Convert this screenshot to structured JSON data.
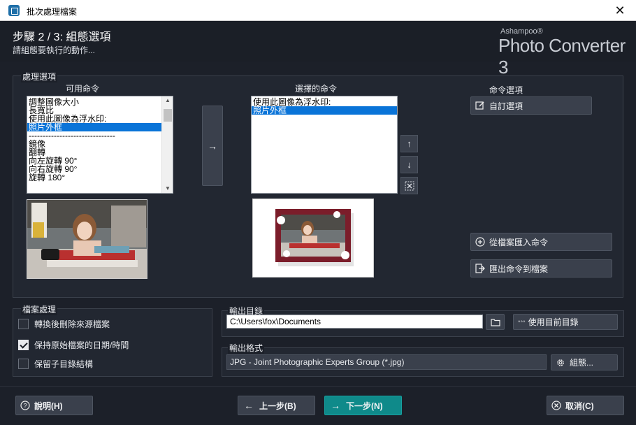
{
  "window": {
    "title": "批次處理檔案",
    "close": "✕"
  },
  "header": {
    "step_title": "步驟 2 / 3: 組態選項",
    "step_subtitle": "請組態要執行的動作...",
    "brand_small": "Ashampoo®",
    "brand_large": "Photo Converter 3"
  },
  "processing": {
    "label": "處理選項",
    "available_label": "可用命令",
    "selected_label": "選擇的命令",
    "options_label": "命令選項",
    "available_items": [
      "調整圖像大小",
      "長寬比",
      "使用此圖像為浮水印:",
      "照片外框",
      "-------------------------------",
      "鏡像",
      "翻轉",
      "向左旋轉 90°",
      "向右旋轉 90°",
      "旋轉 180°"
    ],
    "available_selected_index": 3,
    "selected_items": [
      "使用此圖像為浮水印:",
      "照片外框"
    ],
    "selected_selected_index": 1,
    "add_arrow": "→",
    "move_up": "↑",
    "move_down": "↓",
    "custom_options": "自訂選項",
    "import_commands": "從檔案匯入命令",
    "export_commands": "匯出命令到檔案"
  },
  "file_processing": {
    "label": "檔案處理",
    "options": [
      {
        "label": "轉換後刪除來源檔案",
        "checked": false
      },
      {
        "label": "保持原始檔案的日期/時間",
        "checked": true
      },
      {
        "label": "保留子目錄結構",
        "checked": false
      }
    ]
  },
  "output_dir": {
    "label": "輸出目錄",
    "path": "C:\\Users\\fox\\Documents",
    "use_current": "使用目前目錄",
    "use_current_prefix": "◦◦◦"
  },
  "output_format": {
    "label": "輸出格式",
    "value": "JPG - Joint Photographic Experts Group (*.jpg)",
    "configure": "組態..."
  },
  "footer": {
    "help": "說明(H)",
    "back": "上一步(B)",
    "next": "下一步(N)",
    "cancel": "取消(C)"
  },
  "colors": {
    "accent": "#0f8a8a",
    "selection": "#0a74d8",
    "background": "#1c2029"
  }
}
